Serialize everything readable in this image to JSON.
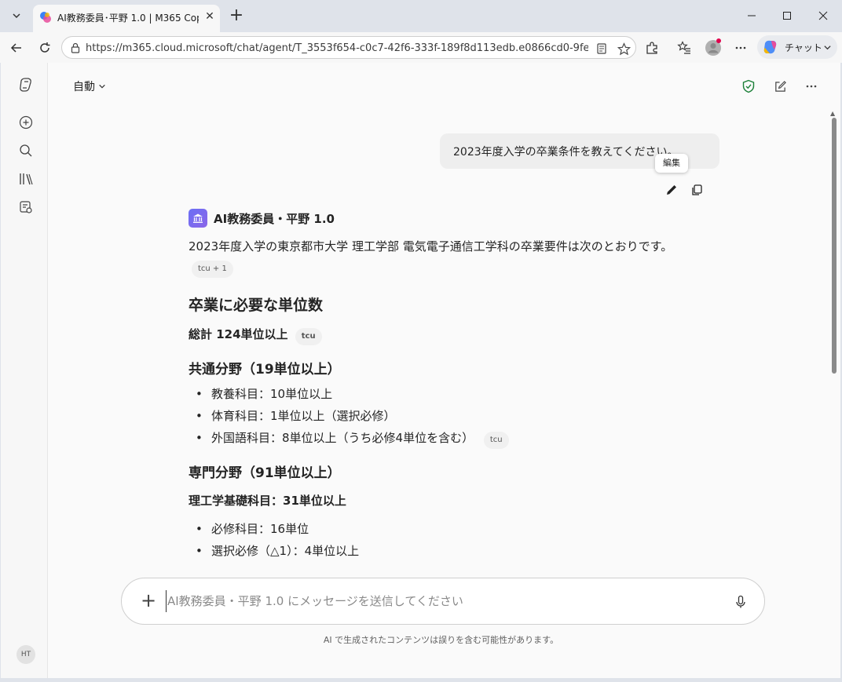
{
  "browser": {
    "tab_title": "AI教務委員･平野 1.0 | M365 Copilot",
    "url": "https://m365.cloud.microsoft/chat/agent/T_3553f654-c0c7-42f6-333f-189f8d113edb.e0866cd0-9fee-...",
    "copilot_button_label": "チャット"
  },
  "header": {
    "mode_label": "自動"
  },
  "conversation": {
    "user_message": "2023年度入学の卒業条件を教えてください。",
    "edit_tooltip": "編集",
    "agent_name": "AI教務委員・平野 1.0",
    "intro": "2023年度入学の東京都市大学 理工学部 電気電子通信工学科の卒業要件は次のとおりです。",
    "cite_intro": "tcu + 1",
    "section_title": "卒業に必要な単位数",
    "total_line": "総計 124単位以上",
    "cite_total": "tcu",
    "common_title": "共通分野（19単位以上）",
    "common_items": [
      "教養科目：10単位以上",
      "体育科目：1単位以上（選択必修）",
      "外国語科目：8単位以上（うち必修4単位を含む）"
    ],
    "cite_common": "tcu",
    "specialty_title": "専門分野（91単位以上）",
    "basics_line": "理工学基礎科目：31単位以上",
    "basics_items": [
      "必修科目：16単位",
      "選択必修（△1）：4単位以上"
    ]
  },
  "composer": {
    "placeholder": "AI教務委員・平野 1.0 にメッセージを送信してください",
    "disclaimer": "AI で生成されたコンテンツは誤りを含む可能性があります。"
  },
  "sidebar": {
    "avatar_initials": "HT"
  },
  "colors": {
    "accent": "#6b6ff5",
    "shield": "#1a7f37"
  }
}
